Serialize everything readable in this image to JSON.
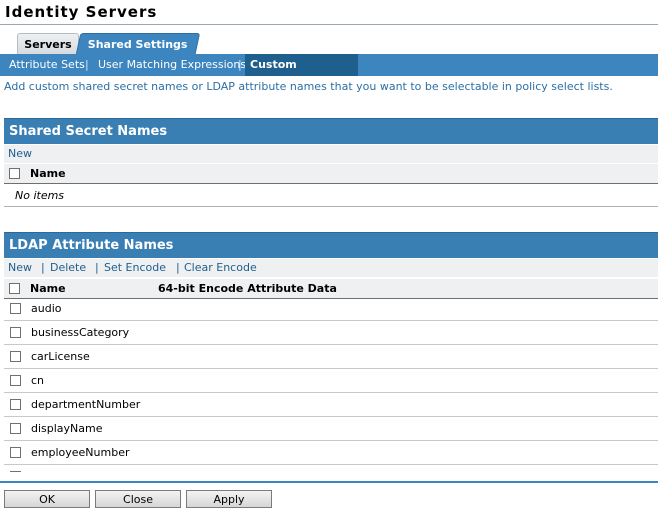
{
  "page": {
    "title": "Identity Servers"
  },
  "tabs": [
    {
      "label": "Servers",
      "active": false
    },
    {
      "label": "Shared Settings",
      "active": true
    }
  ],
  "subnav": {
    "items": [
      "Attribute Sets",
      "User Matching Expressions",
      "Custom Attributes"
    ],
    "selected": "Custom Attributes",
    "separator": "|"
  },
  "description": "Add custom shared secret names or LDAP attribute names that you want to be selectable in policy select lists.",
  "shared_secret": {
    "header": "Shared Secret Names",
    "toolbar": {
      "new": "New"
    },
    "col_name": "Name",
    "empty_text": "No items"
  },
  "ldap": {
    "header": "LDAP Attribute Names",
    "toolbar": {
      "new": "New",
      "delete": "Delete",
      "set_encode": "Set Encode",
      "clear_encode": "Clear Encode"
    },
    "col_name": "Name",
    "col_encode": "64-bit Encode Attribute Data",
    "rows": [
      "audio",
      "businessCategory",
      "carLicense",
      "cn",
      "departmentNumber",
      "displayName",
      "employeeNumber"
    ]
  },
  "buttons": {
    "ok": "OK",
    "close": "Close",
    "apply": "Apply"
  },
  "colors": {
    "accent": "#3c85bf",
    "selected_subnav": "#1f5f8e",
    "link": "#1f5f8e"
  }
}
